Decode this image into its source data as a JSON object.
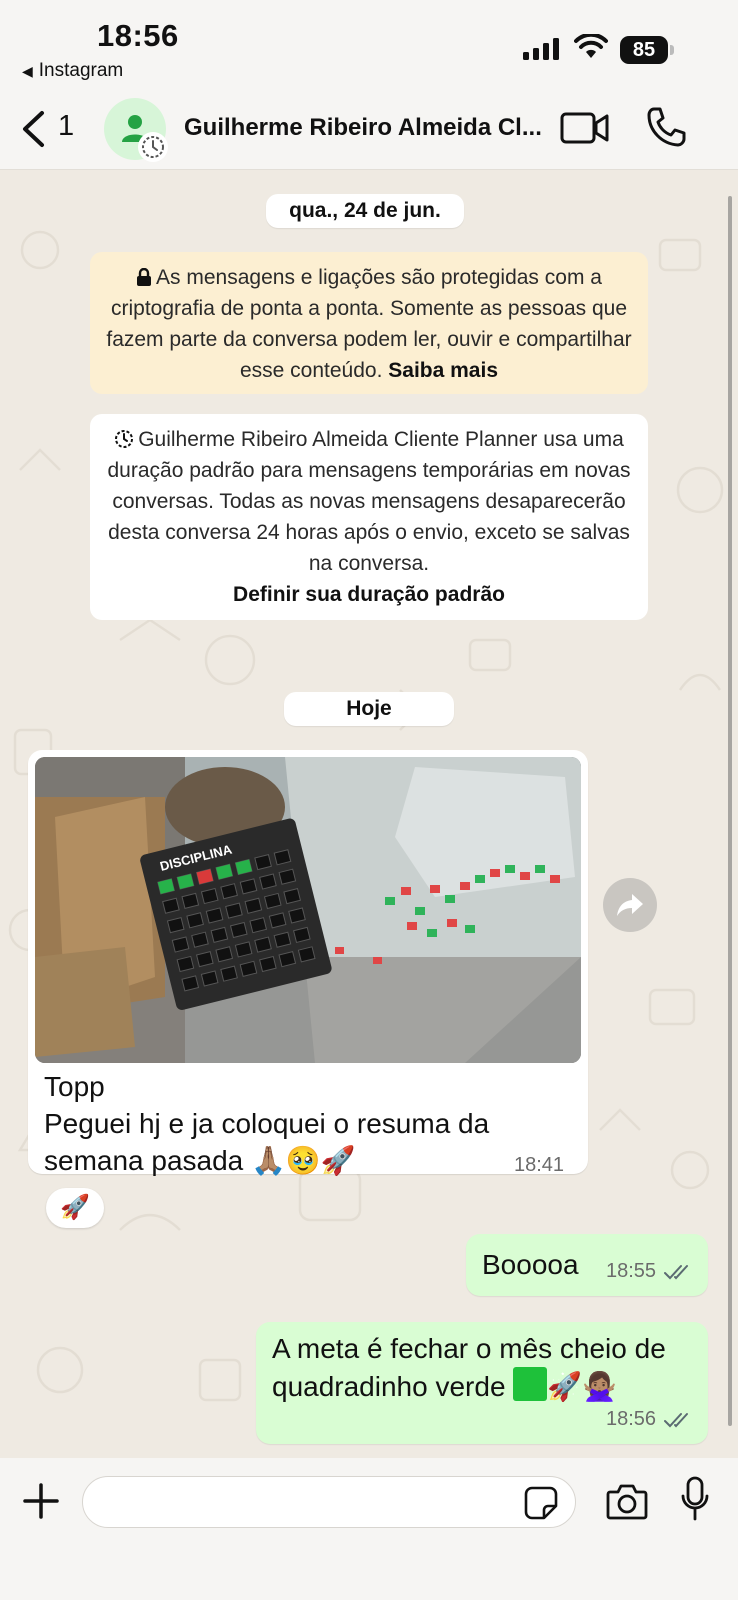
{
  "status_bar": {
    "time": "18:56",
    "back_app_label": "Instagram",
    "battery": "85"
  },
  "header": {
    "unread_count": "1",
    "chat_title": "Guilherme Ribeiro Almeida Cl..."
  },
  "chat": {
    "date_label_1": "qua., 24 de jun.",
    "e2e_notice": "As mensagens e ligações são protegidas com a criptografia de ponta a ponta. Somente as pessoas que fazem parte da conversa podem ler, ouvir e compartilhar esse conteúdo.",
    "e2e_link": "Saiba mais",
    "disappearing_notice": "Guilherme Ribeiro Almeida Cliente Planner usa uma duração padrão para mensagens temporárias em novas conversas. Todas as novas mensagens desaparecerão desta conversa 24 horas após o envio, exceto se salvas na conversa.",
    "disappearing_link": "Definir sua duração padrão",
    "date_label_2": "Hoje",
    "photo_label": "DISCIPLINA",
    "incoming": {
      "line1": "Topp",
      "line2": "Peguei hj e ja coloquei o resuma da",
      "line3": "semana pasada 🙏🏽🥹🚀",
      "time": "18:41",
      "reaction": "🚀"
    },
    "outgoing_1": {
      "text": "Booooa",
      "time": "18:55"
    },
    "outgoing_2": {
      "line1": "A meta é fechar o mês cheio de",
      "line2_text": "quadradinho verde",
      "line2_emoji": "🚀🙅🏽‍♀️",
      "time": "18:56"
    }
  },
  "input": {
    "placeholder": ""
  },
  "colors": {
    "outgoing_bubble": "#d9fdd3",
    "e2e_bg": "#fcefd2",
    "chat_bg": "#efeae2"
  }
}
